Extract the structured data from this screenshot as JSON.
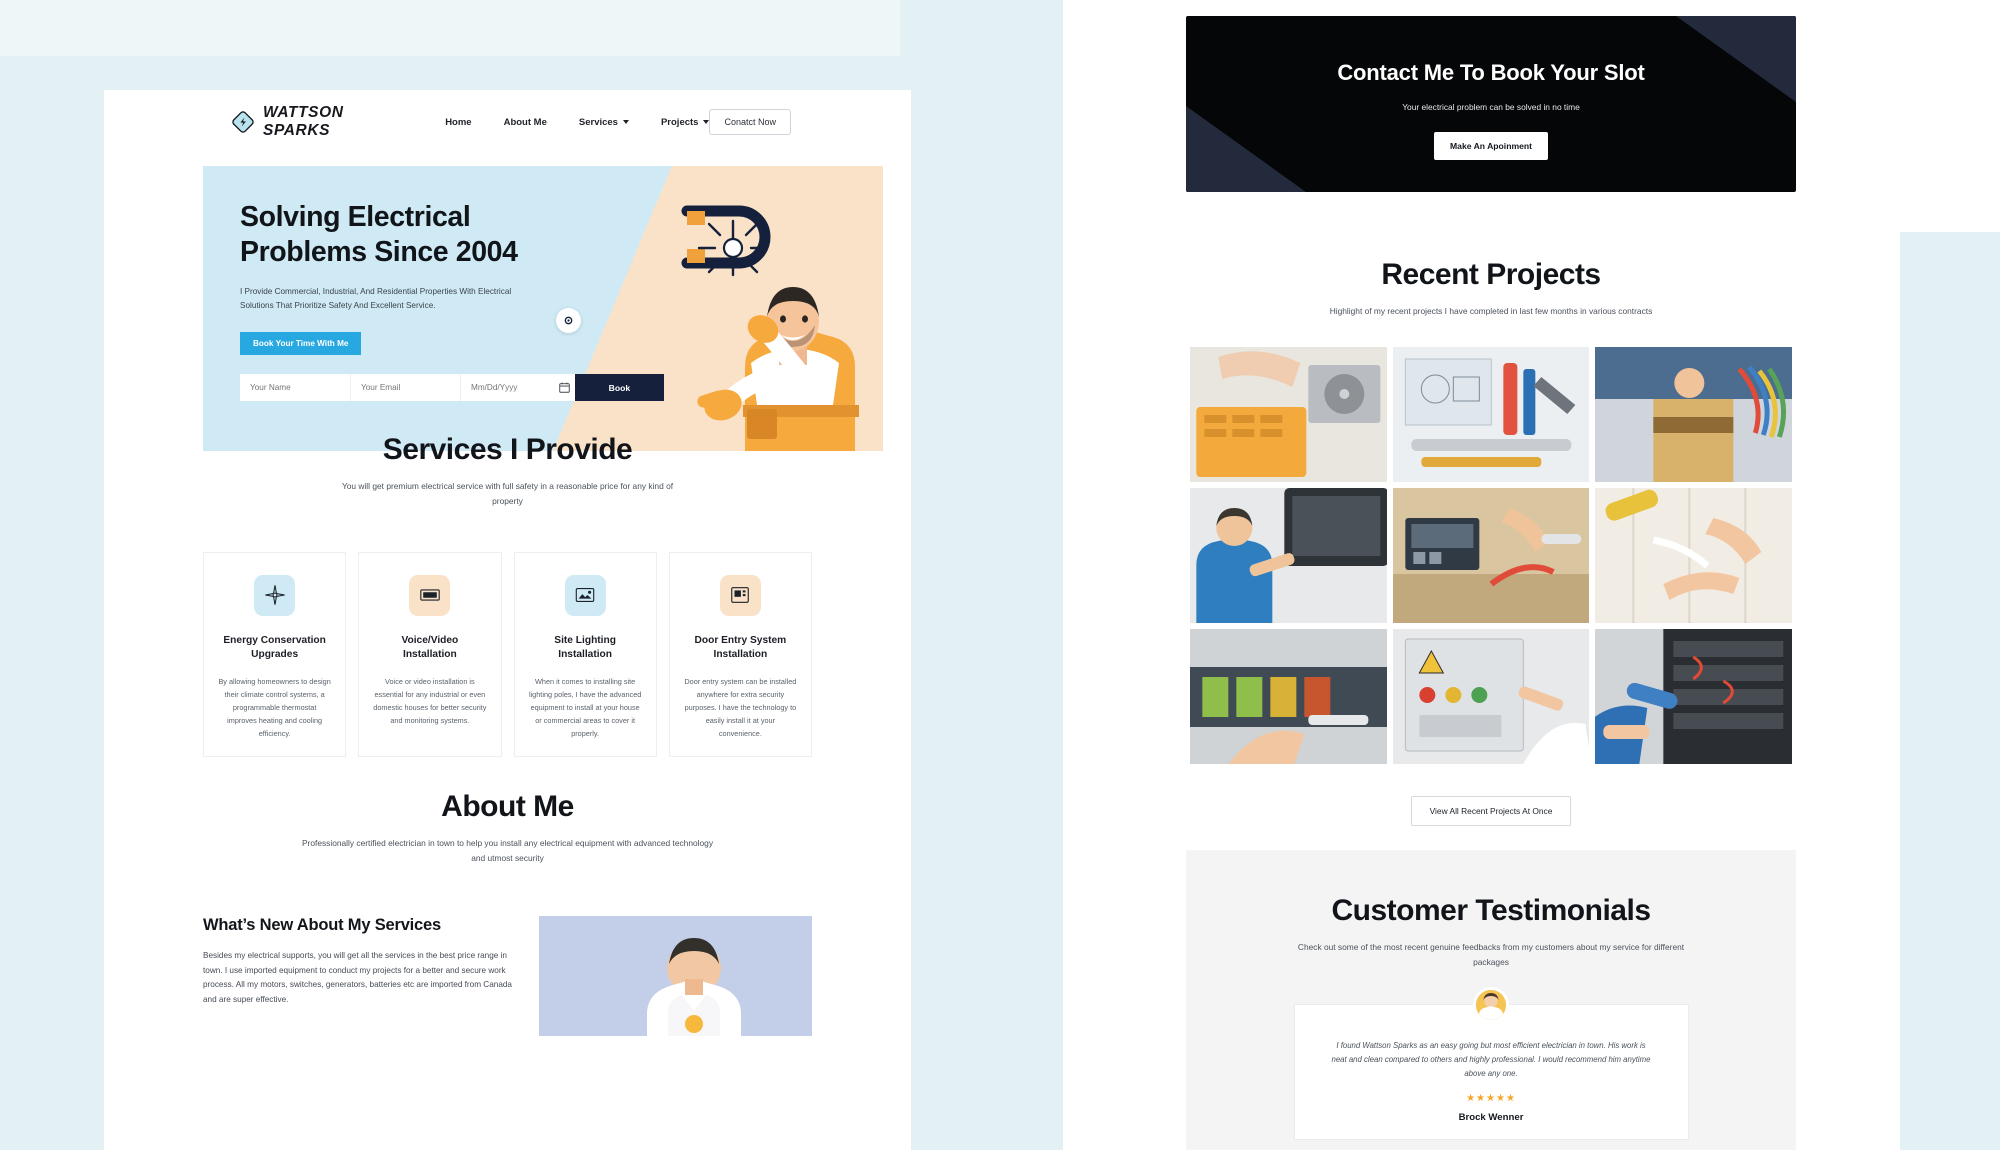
{
  "nav": {
    "brand": "WATTSON SPARKS",
    "links": [
      {
        "label": "Home",
        "caret": false
      },
      {
        "label": "About Me",
        "caret": false
      },
      {
        "label": "Services",
        "caret": true
      },
      {
        "label": "Projects",
        "caret": true
      }
    ],
    "cta": "Conatct Now"
  },
  "hero": {
    "title_line1": "Solving Electrical",
    "title_line2": "Problems Since 2004",
    "subtitle": "I Provide Commercial, Industrial, And Residential Properties With Electrical Solutions That Prioritize Safety And Excellent Service.",
    "cta": "Book Your Time With Me",
    "form": {
      "name_placeholder": "Your Name",
      "email_placeholder": "Your Email",
      "date_placeholder": "Mm/Dd/Yyyy",
      "submit": "Book"
    }
  },
  "services": {
    "title": "Services I Provide",
    "subtitle": "You will get premium electrical service with full safety in a reasonable price for any kind of property",
    "cards": [
      {
        "name": "Energy Conservation Upgrades",
        "desc": "By allowing homeowners to design their climate control systems, a programmable thermostat improves heating and cooling efficiency.",
        "icon": "energy-star-icon",
        "icon_bg": "#cfeaf5"
      },
      {
        "name": "Voice/Video Installation",
        "desc": "Voice or video installation is essential for any industrial or even domestic houses for better security and monitoring systems.",
        "icon": "intercom-panel-icon",
        "icon_bg": "#fae2c8"
      },
      {
        "name": "Site Lighting Installation",
        "desc": "When it comes to installing site lighting poles, I have the advanced equipment to install at your house or commercial areas to cover it properly.",
        "icon": "site-light-icon",
        "icon_bg": "#cfeaf5"
      },
      {
        "name": "Door Entry System Installation",
        "desc": "Door entry system can be installed anywhere for extra security purposes. I have the technology to easily install it at your convenience.",
        "icon": "door-entry-icon",
        "icon_bg": "#fae2c8"
      }
    ]
  },
  "about": {
    "title": "About Me",
    "subtitle": "Professionally certified electrician in town to help you install any electrical equipment with advanced technology and utmost security",
    "heading": "What’s New About My Services",
    "paragraph": "Besides my electrical supports, you will get all the services in the best price range in town. I use imported equipment to conduct my projects for a better and secure work process. All my motors, switches, generators, batteries etc are imported from Canada and are super effective."
  },
  "contact_banner": {
    "title": "Contact Me To Book Your Slot",
    "subtitle": "Your electrical problem can be solved in no time",
    "cta": "Make An Apoinment"
  },
  "projects": {
    "title": "Recent Projects",
    "subtitle": "Highlight of my recent projects I have completed in last few months in various contracts",
    "cta": "View All Recent Projects At Once",
    "items": [
      {
        "alt": "hard-drive-repair-photo"
      },
      {
        "alt": "plumbing-tools-blueprint-photo"
      },
      {
        "alt": "electrician-wiring-bundle-photo"
      },
      {
        "alt": "technician-servicing-unit-photo"
      },
      {
        "alt": "multimeter-testing-socket-photo"
      },
      {
        "alt": "cable-clip-install-photo"
      },
      {
        "alt": "circuit-board-soldering-photo"
      },
      {
        "alt": "control-panel-inspection-photo"
      },
      {
        "alt": "electrical-cabinet-testing-photo"
      }
    ]
  },
  "testimonials": {
    "title": "Customer Testimonials",
    "subtitle": "Check out some of the most recent genuine feedbacks from my customers about my service for different packages",
    "card": {
      "quote": "I found Wattson Sparks as an easy going but most efficient electrician in town. His work is neat and clean compared to others and highly professional. I would recommend him anytime above any one.",
      "stars": "★★★★★",
      "name": "Brock Wenner"
    }
  }
}
